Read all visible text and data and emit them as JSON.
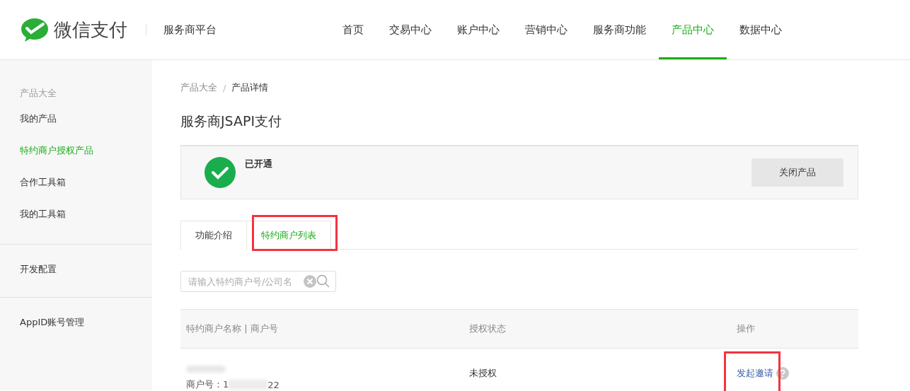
{
  "header": {
    "logo_text": "微信支付",
    "platform": "服务商平台",
    "nav": [
      {
        "label": "首页",
        "selected": false
      },
      {
        "label": "交易中心",
        "selected": false
      },
      {
        "label": "账户中心",
        "selected": false
      },
      {
        "label": "营销中心",
        "selected": false
      },
      {
        "label": "服务商功能",
        "selected": false
      },
      {
        "label": "产品中心",
        "selected": true
      },
      {
        "label": "数据中心",
        "selected": false
      }
    ]
  },
  "sidebar": {
    "groups": [
      {
        "title": "产品大全",
        "items": [
          {
            "label": "我的产品",
            "selected": false
          },
          {
            "label": "特约商户授权产品",
            "selected": true
          },
          {
            "label": "合作工具箱",
            "selected": false
          },
          {
            "label": "我的工具箱",
            "selected": false
          }
        ]
      },
      {
        "items": [
          {
            "label": "开发配置",
            "selected": false
          }
        ]
      },
      {
        "items": [
          {
            "label": "AppID账号管理",
            "selected": false
          }
        ]
      }
    ]
  },
  "breadcrumb": [
    "产品大全",
    "产品详情"
  ],
  "breadcrumb_separator": "/",
  "title": "服务商JSAPI支付",
  "status": {
    "label": "已开通",
    "button": "关闭产品"
  },
  "tabs": [
    {
      "label": "功能介绍",
      "selected": false,
      "highlighted": false
    },
    {
      "label": "特约商户列表",
      "selected": true,
      "highlighted": true
    }
  ],
  "search": {
    "placeholder": "请输入特约商户号/公司名"
  },
  "table": {
    "columns": [
      "特约商户名称 | 商户号",
      "授权状态",
      "操作"
    ],
    "rows": [
      {
        "merchant_id_start": "商户号：1",
        "merchant_id_end": "22",
        "status": "未授权",
        "action": "发起邀请",
        "action_highlighted": true
      }
    ]
  }
}
